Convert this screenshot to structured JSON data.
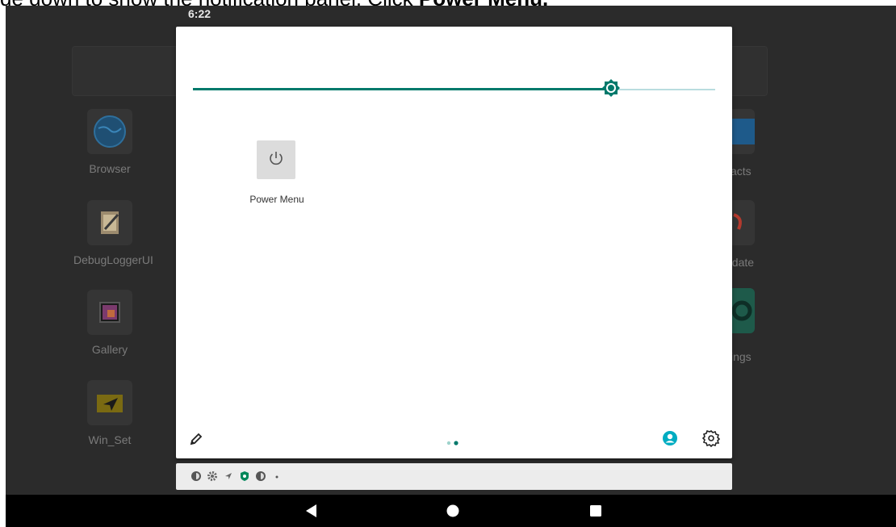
{
  "instruction": {
    "text_plain": "de down to show the notification panel. Click ",
    "text_bold": "Power Menu."
  },
  "status_bar": {
    "time": "6:22"
  },
  "launcher": {
    "left_apps": [
      {
        "label": "Browser",
        "icon": "globe-icon"
      },
      {
        "label": "DebugLoggerUI",
        "icon": "notepad-icon"
      },
      {
        "label": "Gallery",
        "icon": "gallery-icon"
      },
      {
        "label": "Win_Set",
        "icon": "navigation-arrow-icon"
      }
    ],
    "right_apps": [
      {
        "label": "acts",
        "icon": "contacts-icon"
      },
      {
        "label": "pdate",
        "icon": "update-icon"
      },
      {
        "label": "ings",
        "icon": "settings-gear-icon"
      }
    ]
  },
  "quick_settings": {
    "brightness_level": 0.8,
    "tiles": [
      {
        "label": "Power Menu",
        "icon": "power-icon"
      }
    ],
    "footer": {
      "edit_icon": "pencil-icon",
      "page_count": 2,
      "active_page": 2,
      "user_icon": "account-circle-icon",
      "settings_icon": "settings-icon"
    }
  },
  "notification_icons": [
    "app-icon",
    "gear-icon",
    "location-icon",
    "shield-icon",
    "app-icon",
    "more-dot-icon"
  ],
  "navigation": {
    "back_icon": "back-triangle-icon",
    "home_icon": "home-circle-icon",
    "recents_icon": "recents-square-icon"
  },
  "colors": {
    "accent": "#00796b",
    "accent_light": "#b9dcdf",
    "user_icon": "#00acc1"
  }
}
